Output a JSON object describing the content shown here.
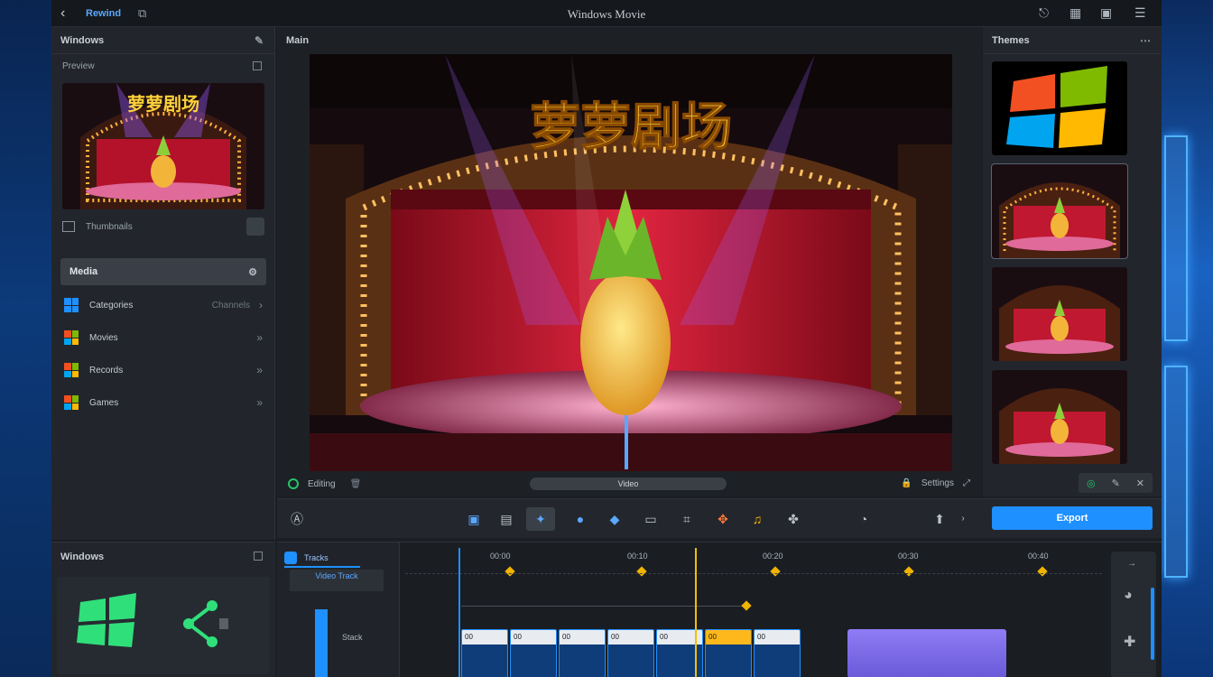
{
  "app": {
    "window_title": "Windows Movie",
    "breadcrumb": "Rewind",
    "left_panel_title": "Windows",
    "left_sub_title": "Preview",
    "left_thumb_footer": "Thumbnails",
    "list_header": "Media",
    "list_items": [
      {
        "label": "Categories",
        "meta": "Channels",
        "colors": [
          "#f25022",
          "#7fba00",
          "#00a4ef",
          "#ffb900"
        ]
      },
      {
        "label": "Movies",
        "meta": "",
        "colors": [
          "#00a4ef",
          "#00a4ef",
          "#00a4ef",
          "#00a4ef"
        ]
      },
      {
        "label": "Records",
        "meta": "",
        "colors": [
          "#f25022",
          "#7fba00",
          "#00a4ef",
          "#ffb900"
        ]
      },
      {
        "label": "Games",
        "meta": "",
        "colors": [
          "#f25022",
          "#7fba00",
          "#00a4ef",
          "#ffb900"
        ]
      }
    ],
    "bottom_left_title": "Windows"
  },
  "preview": {
    "label": "Main",
    "stage_title": "萝萝剧场",
    "left_status": "Editing",
    "center_status": "Video",
    "right_status": "Settings"
  },
  "right_panel": {
    "title": "Themes"
  },
  "toolbar": {
    "export_label": "Export"
  },
  "timeline": {
    "tab_label": "Tracks",
    "track_label": "Video Track",
    "lane_label": "Stack",
    "ruler_labels": [
      "00:00",
      "00:10",
      "00:20",
      "00:30",
      "00:40"
    ],
    "clip_labels": [
      "00",
      "00",
      "00",
      "00",
      "00",
      "00",
      "00"
    ]
  },
  "colors": {
    "accent": "#1e90ff",
    "playhead": "#f0c000",
    "clip_purple": "#8f7cf5",
    "panel_bg": "#22262c"
  }
}
